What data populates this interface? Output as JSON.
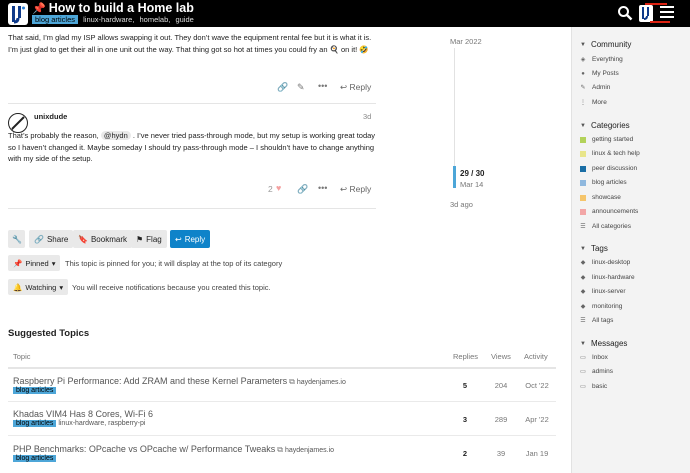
{
  "header": {
    "title": "How to build a Home lab",
    "category": "blog articles",
    "tags": [
      "linux-hardware,",
      "homelab,",
      "guide"
    ]
  },
  "post1": {
    "body": "That said, I’m glad my ISP allows swapping it out. They don’t wave the equipment rental fee but it is what it is. I’m just glad to get their all in one unit out the way. That thing got so hot at times you could fry an 🍳 on it! 🤣",
    "reply": "Reply"
  },
  "post2": {
    "username": "unixdude",
    "date": "3d",
    "body_before": "That’s probably the reason,",
    "mention": "@hydn",
    "body_after": ". I’ve never tried pass-through mode, but my setup is working great today so I haven’t changed it. Maybe someday I should try pass-through mode – I shouldn’t have to change anything with my side of the setup.",
    "likes": "2",
    "reply": "Reply"
  },
  "timeline": {
    "top_date": "Mar 2022",
    "count": "29 / 30",
    "current_date": "Mar 14",
    "bottom": "3d ago"
  },
  "footer": {
    "share": "Share",
    "bookmark": "Bookmark",
    "flag": "Flag",
    "reply": "Reply",
    "pinned": "Pinned",
    "pinned_text": "This topic is pinned for you; it will display at the top of its category",
    "watching": "Watching",
    "watching_text": "You will receive notifications because you created this topic."
  },
  "suggested": {
    "title": "Suggested Topics",
    "columns": {
      "topic": "Topic",
      "replies": "Replies",
      "views": "Views",
      "activity": "Activity"
    },
    "rows": [
      {
        "title": "Raspberry Pi Performance: Add ZRAM and these Kernel Parameters",
        "domain": "haydenjames.io",
        "category": "blog articles",
        "tags": "",
        "replies": "5",
        "views": "204",
        "activity": "Oct '22"
      },
      {
        "title": "Khadas VIM4 Has 8 Cores, Wi-Fi 6",
        "domain": "",
        "category": "blog articles",
        "tags": "linux-hardware,  raspberry-pi",
        "replies": "3",
        "views": "289",
        "activity": "Apr '22"
      },
      {
        "title": "PHP Benchmarks: OPcache vs OPcache w/ Performance Tweaks",
        "domain": "haydenjames.io",
        "category": "blog articles",
        "tags": "",
        "replies": "2",
        "views": "39",
        "activity": "Jan 19"
      }
    ]
  },
  "sidebar": {
    "community": "Community",
    "community_items": [
      "Everything",
      "My Posts",
      "Admin",
      "More"
    ],
    "categories": "Categories",
    "category_items": [
      {
        "label": "getting started",
        "color": "#b3d25a"
      },
      {
        "label": "linux & tech help",
        "color": "#e8e58a"
      },
      {
        "label": "peer discussion",
        "color": "#1a6ea5"
      },
      {
        "label": "blog articles",
        "color": "#8fb8de"
      },
      {
        "label": "showcase",
        "color": "#f5c56b"
      },
      {
        "label": "announcements",
        "color": "#f2a6a6"
      },
      {
        "label": "All categories",
        "color": ""
      }
    ],
    "tags": "Tags",
    "tag_items": [
      "linux-desktop",
      "linux-hardware",
      "linux-server",
      "monitoring",
      "All tags"
    ],
    "messages": "Messages",
    "message_items": [
      "Inbox",
      "admins",
      "basic"
    ]
  }
}
